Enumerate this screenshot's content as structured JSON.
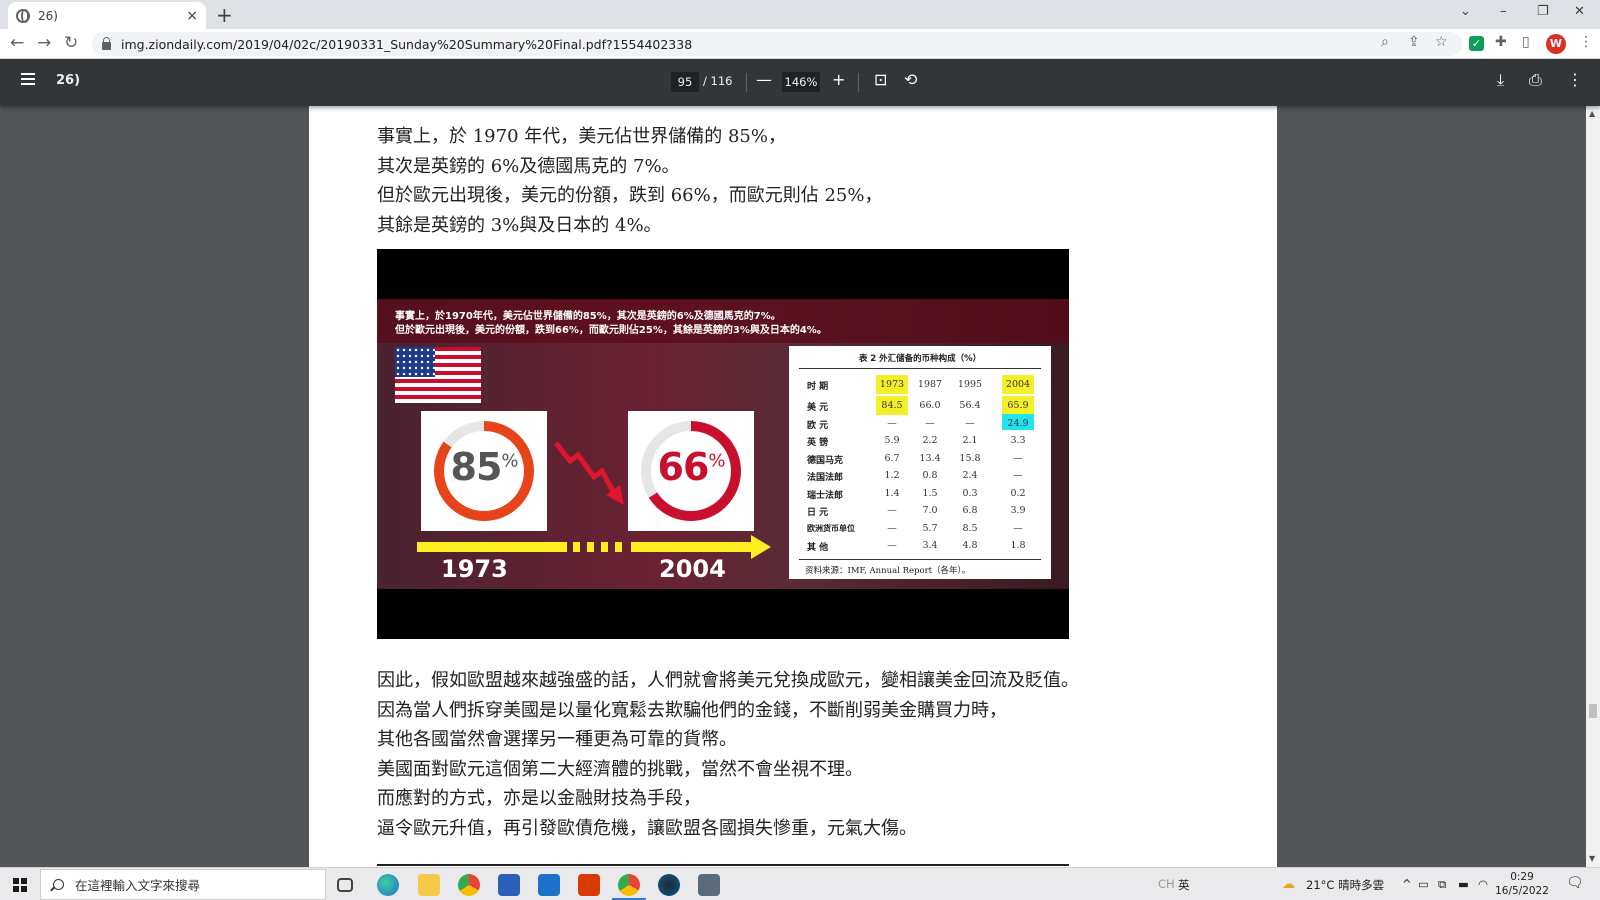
{
  "browser": {
    "tab_title": "26)",
    "tab_close": "×",
    "new_tab": "+",
    "url": "img.ziondaily.com/2019/04/02c/20190331_Sunday%20Summary%20Final.pdf?1554402338",
    "nav": {
      "back": "←",
      "forward": "→",
      "reload": "↻"
    },
    "window": {
      "dropdown": "⌄",
      "minimize": "–",
      "restore": "❐",
      "close": "✕"
    },
    "omni_icons": {
      "zoom": "⌕",
      "share": "⇪",
      "star": "☆",
      "extensions": "✚",
      "sidepanel": "▯",
      "menu": "⋮"
    },
    "ext_check": "✓",
    "avatar_letter": "W"
  },
  "pdf": {
    "title": "26)",
    "page_current": "95",
    "page_total": "/ 116",
    "zoom": "146%",
    "ctl": {
      "minus": "—",
      "plus": "+",
      "fit": "⊡",
      "rotate": "⟲",
      "download": "⤓",
      "print": "⎙",
      "more": "⋮"
    }
  },
  "doc": {
    "para_top": [
      "事實上，於 1970 年代，美元佔世界儲備的 85%，",
      "其次是英鎊的 6%及德國馬克的 7%。",
      "但於歐元出現後，美元的份額，跌到 66%，而歐元則佔 25%，",
      "其餘是英鎊的 3%與及日本的 4%。"
    ],
    "para_bottom": [
      "因此，假如歐盟越來越強盛的話，人們就會將美元兌換成歐元，變相讓美金回流及貶值。",
      "因為當人們拆穿美國是以量化寬鬆去欺騙他們的金錢，不斷削弱美金購買力時，",
      "其他各國當然會選擇另一種更為可靠的貨幣。",
      "美國面對歐元這個第二大經濟體的挑戰，當然不會坐視不理。",
      "而應對的方式，亦是以金融財技為手段，",
      "逼令歐元升值，再引發歐債危機，讓歐盟各國損失慘重，元氣大傷。"
    ]
  },
  "figure": {
    "caption_1": "事實上，於1970年代，美元佔世界儲備的85%，其次是英鎊的6%及德國馬克的7%。",
    "caption_2": "但於歐元出現後，美元的份額，跌到66%，而歐元則佔25%，其餘是英鎊的3%與及日本的4%。",
    "gauge_left": {
      "value": "85",
      "unit": "%",
      "fraction": 0.85,
      "color": "#e8441c"
    },
    "gauge_right": {
      "value": "66",
      "unit": "%",
      "fraction": 0.66,
      "color": "#c8102e"
    },
    "year_left": "1973",
    "year_right": "2004",
    "accent_yellow": "#ffee22"
  },
  "chart_data": {
    "type": "table",
    "title": "表 2  外汇储备的币种构成（%）",
    "header_label": "时  期",
    "columns": [
      "1973",
      "1987",
      "1995",
      "2004"
    ],
    "rows": [
      {
        "label": "美  元",
        "values": [
          "84.5",
          "66.0",
          "56.4",
          "65.9"
        ]
      },
      {
        "label": "欧  元",
        "values": [
          "—",
          "—",
          "—",
          "24.9"
        ]
      },
      {
        "label": "英  镑",
        "values": [
          "5.9",
          "2.2",
          "2.1",
          "3.3"
        ]
      },
      {
        "label": "德国马克",
        "values": [
          "6.7",
          "13.4",
          "15.8",
          "—"
        ]
      },
      {
        "label": "法国法郎",
        "values": [
          "1.2",
          "0.8",
          "2.4",
          "—"
        ]
      },
      {
        "label": "瑞士法郎",
        "values": [
          "1.4",
          "1.5",
          "0.3",
          "0.2"
        ]
      },
      {
        "label": "日  元",
        "values": [
          "—",
          "7.0",
          "6.8",
          "3.9"
        ]
      },
      {
        "label": "欧洲货币单位",
        "values": [
          "—",
          "5.7",
          "8.5",
          "—"
        ]
      },
      {
        "label": "其  他",
        "values": [
          "—",
          "3.4",
          "4.8",
          "1.8"
        ]
      }
    ],
    "source": "资料来源：IMF, Annual Report（各年）。"
  },
  "taskbar": {
    "search_placeholder": "在這裡輸入文字來搜尋",
    "ime": "CH",
    "ime2": "英",
    "weather": "21°C  晴時多雲",
    "tray_arrow": "^",
    "time": "0:29",
    "date": "16/5/2022",
    "notify": "🗨"
  }
}
